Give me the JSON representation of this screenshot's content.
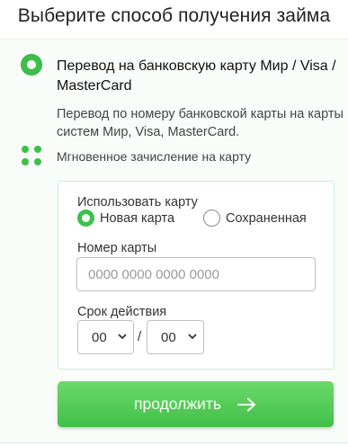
{
  "page": {
    "title": "Выберите способ получения займа"
  },
  "method": {
    "title": "Перевод на банковскую карту Мир / Visa / MasterCard",
    "description": "Перевод по номеру банковской карты на карты систем Мир, Visa, MasterCard.",
    "feature": "Мгновенное зачисление на карту",
    "selected": true
  },
  "form": {
    "use_card_label": "Использовать карту",
    "options": [
      {
        "label": "Новая карта",
        "selected": true
      },
      {
        "label": "Сохраненная",
        "selected": false
      }
    ],
    "card_number_label": "Номер карты",
    "card_number_placeholder": "0000 0000 0000 0000",
    "card_number_value": "",
    "expiry_label": "Срок действия",
    "expiry_month": "00",
    "expiry_separator": "/",
    "expiry_year": "00"
  },
  "actions": {
    "continue_label": "продолжить"
  },
  "colors": {
    "accent": "#3cc04a",
    "card_border": "#c9ecd0",
    "panel_bg": "#f8fdf9"
  },
  "icons": [
    "radio-selected-icon",
    "dots-grid-icon",
    "chevron-down-icon",
    "arrow-right-icon"
  ]
}
